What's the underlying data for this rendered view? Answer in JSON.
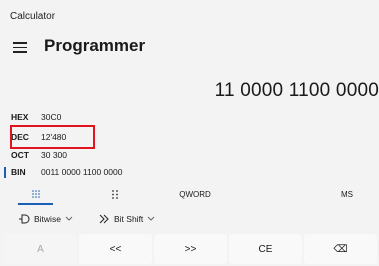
{
  "window": {
    "title": "Calculator"
  },
  "header": {
    "mode": "Programmer"
  },
  "display": {
    "value": "11 0000 1100 0000"
  },
  "radix": [
    {
      "label": "HEX",
      "value": "30C0"
    },
    {
      "label": "DEC",
      "value": "12'480"
    },
    {
      "label": "OCT",
      "value": "30 300"
    },
    {
      "label": "BIN",
      "value": "0011 0000 1100 0000"
    }
  ],
  "tabs": {
    "word_size": "QWORD",
    "memory": "MS"
  },
  "toolbar": {
    "bitwise": "Bitwise",
    "bitshift": "Bit Shift"
  },
  "keys": [
    "A",
    "<<",
    ">>",
    "CE",
    "⌫"
  ],
  "colors": {
    "accent": "#1a5fb4",
    "highlight": "#e0141e"
  }
}
